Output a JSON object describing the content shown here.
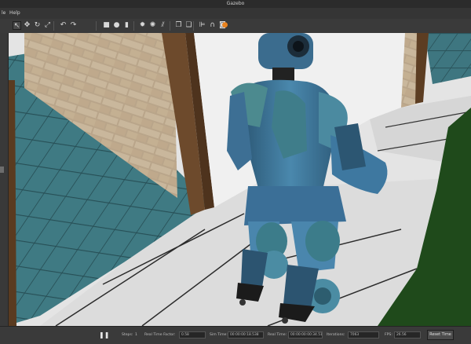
{
  "window": {
    "title": "Gazebo"
  },
  "menu": {
    "file": "le",
    "help": "Help"
  },
  "toolbar": {
    "tools": [
      {
        "name": "select-arrow-icon",
        "glyph": "↖"
      },
      {
        "name": "translate-icon",
        "glyph": "✥"
      },
      {
        "name": "rotate-icon",
        "glyph": "↻"
      },
      {
        "name": "scale-icon",
        "glyph": "⤢"
      },
      {
        "name": "undo-icon",
        "glyph": "↶"
      },
      {
        "name": "redo-icon",
        "glyph": "↷"
      },
      {
        "name": "box-shape-icon",
        "glyph": "■"
      },
      {
        "name": "sphere-shape-icon",
        "glyph": "●"
      },
      {
        "name": "cylinder-shape-icon",
        "glyph": "▮"
      },
      {
        "name": "point-light-icon",
        "glyph": "✹"
      },
      {
        "name": "spot-light-icon",
        "glyph": "✺"
      },
      {
        "name": "directional-light-icon",
        "glyph": "⫽"
      },
      {
        "name": "copy-icon",
        "glyph": "❐"
      },
      {
        "name": "paste-icon",
        "glyph": "❏"
      },
      {
        "name": "align-icon",
        "glyph": "⊫"
      },
      {
        "name": "snap-icon",
        "glyph": "∩"
      },
      {
        "name": "screenshot-icon",
        "glyph": "◙"
      },
      {
        "name": "record-icon",
        "glyph": "●"
      }
    ],
    "accent": "#e8821e"
  },
  "status": {
    "pause_glyph": "❚❚",
    "steps_label": "Steps:",
    "steps_value": "1",
    "rtf_label": "Real Time Factor:",
    "rtf_value": "0.58",
    "sim_time_label": "Sim Time:",
    "sim_time_value": "00:00:00:18.538",
    "real_time_label": "Real Time:",
    "real_time_value": "00:00:00:00:34.512",
    "iterations_label": "Iterations:",
    "iterations_value": "7063",
    "fps_label": "FPS:",
    "fps_value": "26.56",
    "reset_label": "Reset Time"
  }
}
